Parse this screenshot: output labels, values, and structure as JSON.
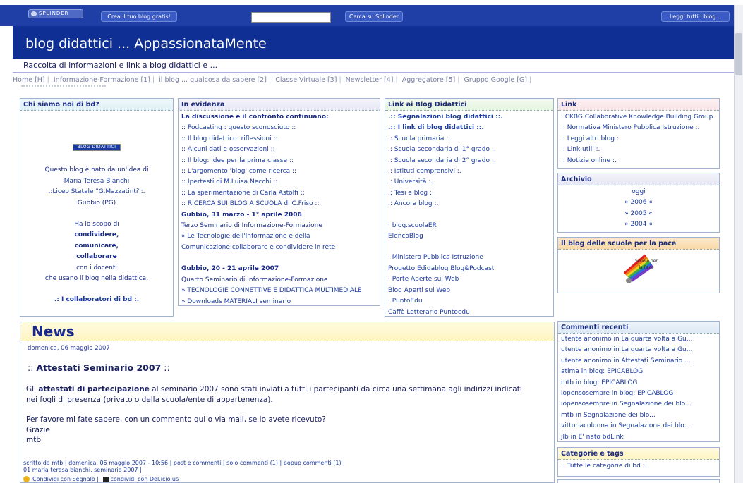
{
  "topbar": {
    "logo_text": "SPLINDER",
    "create_blog": "Crea il tuo blog gratis!",
    "search_button": "Cerca su Splinder",
    "read_all": "Leggi tutti i blog..."
  },
  "header": {
    "title": "blog didattici ... AppassionataMente",
    "subtitle": "Raccolta di informazioni e link a blog didattici e ..."
  },
  "nav": {
    "items": [
      "Home [H]",
      "Informazione-Formazione [1]",
      "il blog ... qualcosa da sapere [2]",
      "Classe Virtuale [3]",
      "Newsletter [4]",
      "Aggregatore [5]",
      "Gruppo Google [G]"
    ]
  },
  "chi_siamo": {
    "title": "Chi siamo noi di bd?",
    "badge": "BLOG DIDATTICI",
    "lines": [
      "Questo blog è nato da un'idea di",
      "Maria Teresa Bianchi",
      ".:Liceo Statale \"G.Mazzatinti\":.",
      "Gubbio (PG)",
      "",
      "Ha lo scopo di",
      "condividere,",
      "comunicare,",
      "collaborare",
      "con i docenti",
      "che usano il blog nella didattica.",
      "",
      ".: I collaboratori di bd :."
    ]
  },
  "evidenza": {
    "title": "In evidenza",
    "lines": [
      "La discussione e il confronto continuano:",
      ":: Podcasting : questo sconosciuto ::",
      ":: Il blog didattico: riflessioni ::",
      ":: Alcuni dati e osservazioni ::",
      ":: Il blog: idee per la prima classe ::",
      ":: L'argomento 'blog' come ricerca ::",
      ":: Ipertesti di M.Luisa Necchi ::",
      ":: La sperimentazione di Carla Astolfi ::",
      ":: RICERCA SUI BLOG A SCUOLA di C.Friso ::",
      "Gubbio, 31 marzo - 1° aprile 2006",
      "Terzo Seminario di Informazione-Formazione",
      "» Le Tecnologie dell'Informazione e della",
      "Comunicazione:collaborare e condividere in rete",
      "",
      "Gubbio, 20 - 21 aprile 2007",
      "Quarto Seminario di Informazione-Formazione",
      "» TECNOLOGIE CONNETTIVE E DIDATTICA MULTIMEDIALE",
      "» Downloads MATERIALI seminario"
    ]
  },
  "link_blog": {
    "title": "Link ai Blog Didattici",
    "lines": [
      ".:: Segnalazioni blog didattici ::.",
      ".:: I link di blog didattici ::.",
      ".: Scuola primaria :.",
      ".: Scuola secondaria di 1° grado :.",
      ".: Scuola secondaria di 2° grado :.",
      ".: Istituti comprensivi :.",
      ".: Università :.",
      ".: Tesi e blog :.",
      ".: Ancora blog :.",
      "",
      "· blog.scuolaER",
      "ElencoBlog",
      "",
      "· Ministero Pubblica Istruzione",
      "Progetto Edidablog Blog&Podcast",
      "· Porte Aperte sul Web",
      "Blog Aperti sul Web",
      "· PuntoEdu",
      "Caffè Letterario Puntoedu"
    ]
  },
  "link": {
    "title": "Link",
    "lines": [
      "· CKBG Collaborative Knowledge Building Group",
      ".: Normativa Ministero Pubblica Istruzione :.",
      ".: Leggi altri blog :",
      ".: Link utili :.",
      ".: Notizie online :."
    ]
  },
  "archivio": {
    "title": "Archivio",
    "lines": [
      "oggi",
      "» 2006 «",
      "» 2005 «",
      "» 2004 «"
    ]
  },
  "pace": {
    "title": "Il blog delle scuole per la pace",
    "image_text": "Scuole per la Pace"
  },
  "commenti": {
    "title": "Commenti recenti",
    "lines": [
      "utente anonimo in La quarta volta a Gu...",
      "utente anonimo in La quarta volta a Gu...",
      "utente anonimo in Attestati Seminario ...",
      "atima in blog: EPICABLOG",
      "mtb in blog: EPICABLOG",
      "iopensosempre in blog: EPICABLOG",
      "iopensosempre in Segnalazione dei blo...",
      "mtb in Segnalazione dei blo...",
      "vittoriacolonna in Segnalazione dei blo...",
      "jlb in E' nato bdLink"
    ]
  },
  "categorie": {
    "title": "Categorie e tags",
    "lines": [
      ".: Tutte le categorie di bd :."
    ]
  },
  "news": {
    "heading": "News",
    "date": "domenica, 06 maggio 2007",
    "post_title_prefix": ":: ",
    "post_title": "Attestati Seminario 2007",
    "post_title_suffix": " ::",
    "body_pre": "Gli ",
    "body_bold": "attestati di partecipazione",
    "body_post": " al seminario 2007 sono stati inviati a tutti i partecipanti da circa una settimana agli indirizzi indicati",
    "body_line2": " nei fogli di presenza (privato o della scuola/ente di appartenenza).",
    "body_line3": "Per favore mi fate sapere, con un commento qui o via mail, se lo avete ricevuto?",
    "body_line4": "Grazie",
    "body_line5": "mtb",
    "footer1": "scritto da mtb | domenica, 06 maggio 2007 - 10:56 | post e commenti | solo commenti (1) | popup commenti (1) |",
    "footer2": "01 maria teresa bianchi, seminario 2007 |",
    "share1": "Condividi con Segnalo |",
    "share2": "condividi con Del.icio.us"
  }
}
